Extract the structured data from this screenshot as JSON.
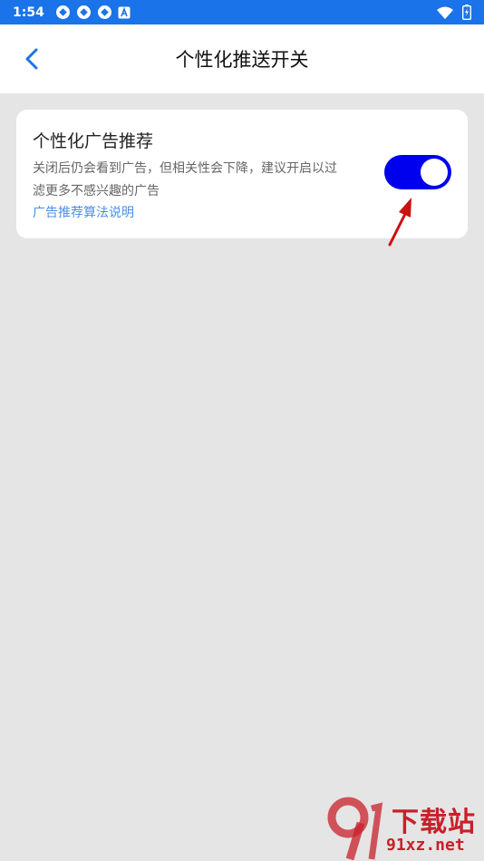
{
  "status_bar": {
    "time": "1:54",
    "color": "#1a73e8",
    "icons": [
      "shutter-icon",
      "shutter-icon",
      "shutter-icon",
      "a-badge-icon",
      "wifi-icon",
      "battery-charging-icon"
    ]
  },
  "header": {
    "title": "个性化推送开关",
    "back_icon": "chevron-left-icon"
  },
  "setting": {
    "title": "个性化广告推荐",
    "description": "关闭后仍会看到广告，但相关性会下降，建议开启以过滤更多不感兴趣的广告",
    "link": "广告推荐算法说明",
    "toggle_on": true,
    "toggle_color": "#0000ee",
    "link_color": "#4a8fe8"
  },
  "watermark": {
    "brand": "下载站",
    "domain": "91xz.net",
    "color": "#c8202a"
  }
}
